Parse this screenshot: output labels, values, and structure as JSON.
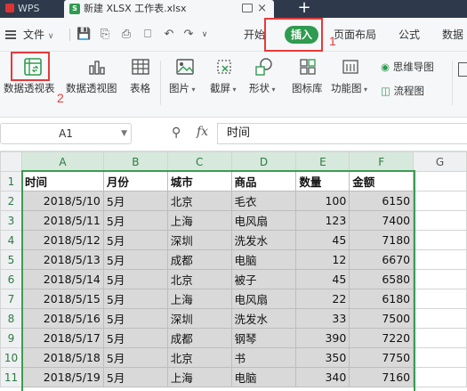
{
  "tabs": {
    "app_label": "WPS",
    "file_label": "新建 XLSX 工作表.xlsx",
    "new_tab_label": "+"
  },
  "menu": {
    "file_label": "文件",
    "start_label": "开始",
    "insert_label": "插入",
    "page_layout_label": "页面布局",
    "formula_label": "公式",
    "data_label": "数据"
  },
  "ribbon": {
    "pivot_table_label": "数据透视表",
    "pivot_chart_label": "数据透视图",
    "table_label": "表格",
    "picture_label": "图片",
    "screenshot_label": "截屏",
    "shape_label": "形状",
    "icon_lib_label": "图标库",
    "function_chart_label": "功能图",
    "mind_map_label": "思维导图",
    "flow_chart_label": "流程图"
  },
  "annotations": {
    "step1": "1",
    "step2": "2",
    "accent": "#e63a3a"
  },
  "formula_bar": {
    "cell_ref": "A1",
    "fx": "fx",
    "value": "时间"
  },
  "colors": {
    "brand_green": "#2e9b4f",
    "selection_border": "#3e9b52",
    "selected_fill": "#d9d9d9"
  },
  "sheet": {
    "columns": [
      "A",
      "B",
      "C",
      "D",
      "E",
      "F",
      "G"
    ],
    "header": [
      "时间",
      "月份",
      "城市",
      "商品",
      "数量",
      "金额"
    ],
    "rows": [
      {
        "num": "1"
      },
      {
        "num": "2",
        "cells": [
          "2018/5/10",
          "5月",
          "北京",
          "毛衣",
          "100",
          "6150"
        ]
      },
      {
        "num": "3",
        "cells": [
          "2018/5/11",
          "5月",
          "上海",
          "电风扇",
          "123",
          "7400"
        ]
      },
      {
        "num": "4",
        "cells": [
          "2018/5/12",
          "5月",
          "深圳",
          "洗发水",
          "45",
          "7180"
        ]
      },
      {
        "num": "5",
        "cells": [
          "2018/5/13",
          "5月",
          "成都",
          "电脑",
          "12",
          "6670"
        ]
      },
      {
        "num": "6",
        "cells": [
          "2018/5/14",
          "5月",
          "北京",
          "被子",
          "45",
          "6580"
        ]
      },
      {
        "num": "7",
        "cells": [
          "2018/5/15",
          "5月",
          "上海",
          "电风扇",
          "22",
          "6180"
        ]
      },
      {
        "num": "8",
        "cells": [
          "2018/5/16",
          "5月",
          "深圳",
          "洗发水",
          "33",
          "7500"
        ]
      },
      {
        "num": "9",
        "cells": [
          "2018/5/17",
          "5月",
          "成都",
          "钢琴",
          "390",
          "7220"
        ]
      },
      {
        "num": "10",
        "cells": [
          "2018/5/18",
          "5月",
          "北京",
          "书",
          "350",
          "7750"
        ]
      },
      {
        "num": "11",
        "cells": [
          "2018/5/19",
          "5月",
          "上海",
          "电脑",
          "340",
          "7160"
        ]
      }
    ]
  }
}
